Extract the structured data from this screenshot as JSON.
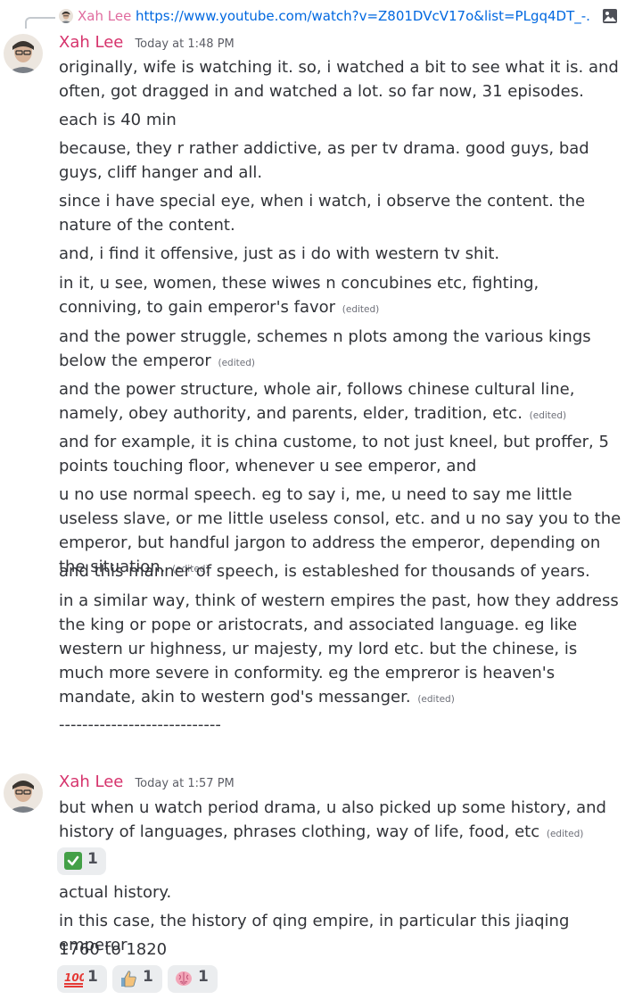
{
  "reply": {
    "author": "Xah Lee",
    "text": "https://www.youtube.com/watch?v=Z801DVcV17o&list=PLgq4DT_-...",
    "media_icon": "image-icon"
  },
  "messages": [
    {
      "author": "Xah Lee",
      "timestamp": "Today at 1:48 PM",
      "lines": [
        {
          "text": "originally, wife is watching it. so, i watched a bit to see what it is. and often, got dragged in and watched a lot. so far now, 31 episodes.",
          "edited": ""
        },
        {
          "text": "each is 40 min",
          "edited": ""
        },
        {
          "text": "because, they r rather addictive, as per tv drama. good guys, bad guys, cliff hanger and all.",
          "edited": ""
        },
        {
          "text": "since i have special eye, when i watch, i observe the content. the nature of the content.",
          "edited": ""
        },
        {
          "text": "and, i find it offensive, just as i do with western tv shit.",
          "edited": ""
        },
        {
          "text": "in it, u see, women, these wiwes n concubines etc, fighting, conniving, to gain emperor's favor",
          "edited": "(edited)"
        },
        {
          "text": "and the power struggle, schemes n plots among the various kings below the emperor",
          "edited": "(edited)"
        },
        {
          "text": "and the power structure, whole air, follows chinese cultural line, namely, obey authority, and parents, elder, tradition, etc.",
          "edited": "(edited)"
        },
        {
          "text": "and for example, it is china custome, to not just kneel, but proffer, 5 points touching floor, whenever u see emperor, and",
          "edited": ""
        },
        {
          "text": "u no use normal speech. eg to say i, me, u need to say me little useless slave, or me little useless consol, etc. and u no say you to the emperor, but handful jargon to address the emperor, depending on the situation.",
          "edited": "(edited)"
        },
        {
          "text": "and this manner of speech, is estableshed for thousands of years.",
          "edited": ""
        },
        {
          "text": "in a similar way, think of western empires the past, how they address the king or pope or aristocrats, and associated language. eg like western ur highness, ur majesty, my lord etc. but the chinese, is much more severe in conformity. eg the empreror is heaven's mandate, akin to western god's messanger.",
          "edited": "(edited)"
        },
        {
          "text": "----------------------------",
          "edited": ""
        }
      ]
    },
    {
      "author": "Xah Lee",
      "timestamp": "Today at 1:57 PM",
      "lines": [
        {
          "text": "but when u watch period drama, u also picked up some history, and history of languages, phrases clothing, way of life, food, etc",
          "edited": "(edited)"
        },
        {
          "text": "actual history.",
          "edited": ""
        },
        {
          "text": "in this case, the history of qing empire, in particular this jiaqing emperor",
          "edited": ""
        },
        {
          "text": "1760 to 1820",
          "edited": ""
        }
      ],
      "reactions_after_line_0": [
        {
          "emoji": "check-mark-icon",
          "count": "1"
        }
      ],
      "reactions_end": [
        {
          "emoji": "hundred-points-icon",
          "count": "1"
        },
        {
          "emoji": "thumbs-up-icon",
          "count": "1"
        },
        {
          "emoji": "brain-icon",
          "count": "1"
        }
      ]
    }
  ]
}
